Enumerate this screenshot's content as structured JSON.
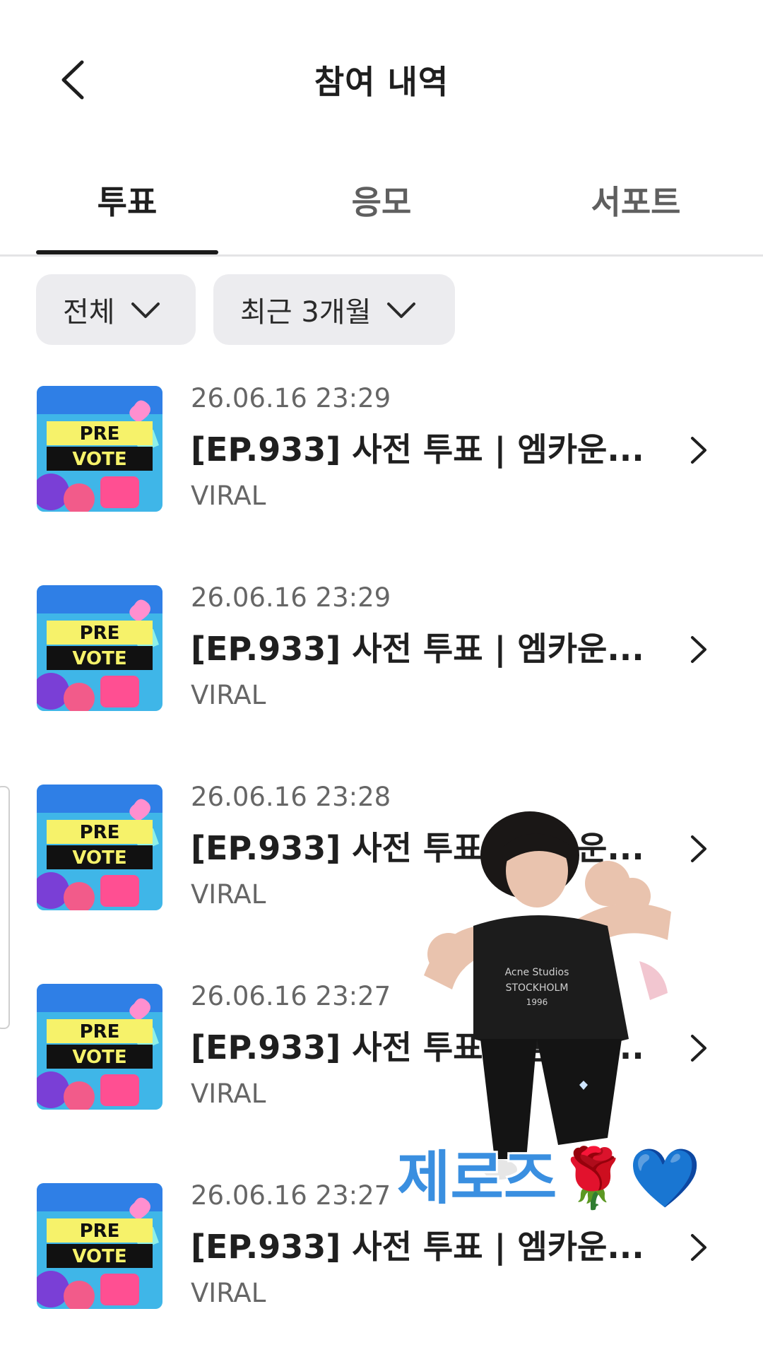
{
  "header": {
    "title": "참여 내역",
    "back_icon": "chevron-left-icon"
  },
  "tabs": [
    {
      "label": "투표",
      "active": true
    },
    {
      "label": "응모",
      "active": false
    },
    {
      "label": "서포트",
      "active": false
    }
  ],
  "filters": [
    {
      "label": "전체",
      "icon": "chevron-down-icon"
    },
    {
      "label": "최근 3개월",
      "icon": "chevron-down-icon"
    }
  ],
  "thumbnail": {
    "line1": "PRE",
    "line2": "VOTE",
    "bg_color": "#3fb6e8",
    "band_color": "#f6f26a"
  },
  "items": [
    {
      "date": "26.06.16 23:29",
      "title": "[EP.933] 사전 투표 | 엠카운...",
      "source": "VIRAL"
    },
    {
      "date": "26.06.16 23:29",
      "title": "[EP.933] 사전 투표 | 엠카운...",
      "source": "VIRAL"
    },
    {
      "date": "26.06.16 23:28",
      "title": "[EP.933] 사전 투표 | 엠카운...",
      "source": "VIRAL"
    },
    {
      "date": "26.06.16 23:27",
      "title": "[EP.933] 사전 투표 | 엠카운...",
      "source": "VIRAL"
    },
    {
      "date": "26.06.16 23:27",
      "title": "[EP.933] 사전 투표 | 엠카운...",
      "source": "VIRAL"
    }
  ],
  "sticker": {
    "text": "제로즈🌹💙",
    "shirt_text_1": "Acne Studios",
    "shirt_text_2": "STOCKHOLM",
    "shirt_text_3": "1996"
  }
}
